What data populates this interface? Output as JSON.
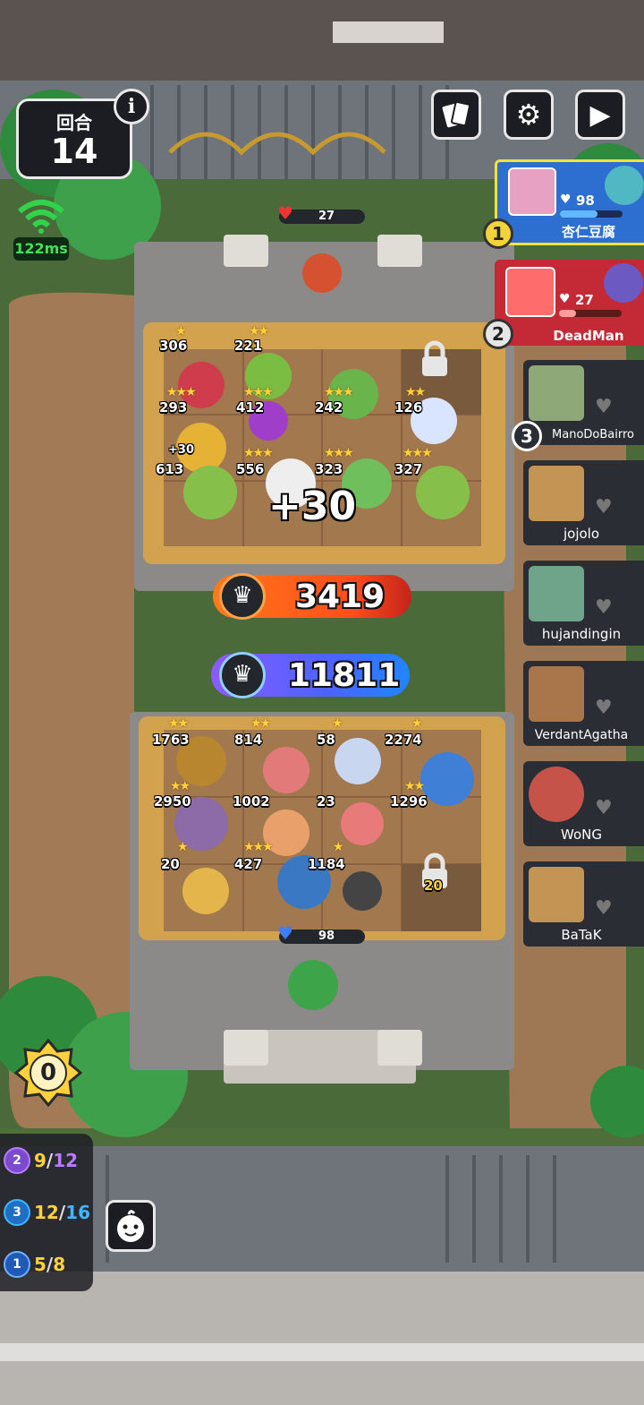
{
  "round": {
    "label": "回合",
    "number": "14"
  },
  "network": {
    "ping": "122ms"
  },
  "top_buttons": [
    "cards-icon",
    "gear-icon",
    "play-icon"
  ],
  "players": [
    {
      "rank": "1",
      "name": "杏仁豆腐",
      "hp": "98"
    },
    {
      "rank": "2",
      "name": "DeadMan",
      "hp": "27"
    },
    {
      "rank": "3",
      "name": "ManoDoBairro"
    },
    {
      "name": "jojolo"
    },
    {
      "name": "hujandingin"
    },
    {
      "name": "VerdantAgatha"
    },
    {
      "name": "WoNG"
    },
    {
      "name": "BaTaK"
    }
  ],
  "enemy": {
    "hp": "27",
    "units": [
      {
        "power": "306",
        "stars": "★"
      },
      {
        "power": "221",
        "stars": "★★"
      },
      {
        "power": "293",
        "stars": "★★★"
      },
      {
        "power": "412",
        "stars": "★★★"
      },
      {
        "power": "242",
        "stars": "★★★"
      },
      {
        "power": "126",
        "stars": "★★"
      },
      {
        "power": "613",
        "stars": "+30"
      },
      {
        "power": "556",
        "stars": "★★★"
      },
      {
        "power": "323",
        "stars": "★★★"
      },
      {
        "power": "327",
        "stars": "★★★"
      }
    ],
    "bonus": "+30",
    "total_power": "3419"
  },
  "player_board": {
    "total_power": "11811",
    "hp": "98",
    "lock_level": "20",
    "units": [
      {
        "power": "1763",
        "stars": "★★"
      },
      {
        "power": "814",
        "stars": "★★"
      },
      {
        "power": "58",
        "stars": "★"
      },
      {
        "power": "2274",
        "stars": "★"
      },
      {
        "power": "2950",
        "stars": "★★"
      },
      {
        "power": "1002",
        "stars": ""
      },
      {
        "power": "23",
        "stars": ""
      },
      {
        "power": "1296",
        "stars": "★★"
      },
      {
        "power": "20",
        "stars": "★"
      },
      {
        "power": "427",
        "stars": "★★★"
      },
      {
        "power": "1184",
        "stars": "★"
      }
    ]
  },
  "gold": "0",
  "tiers": [
    {
      "tier": "2",
      "current": "9",
      "max": "12",
      "color": "#b97cff"
    },
    {
      "tier": "3",
      "current": "12",
      "max": "16",
      "color": "#3fb6ff"
    },
    {
      "tier": "1",
      "current": "5",
      "max": "8",
      "color": "#ffd23d"
    }
  ]
}
